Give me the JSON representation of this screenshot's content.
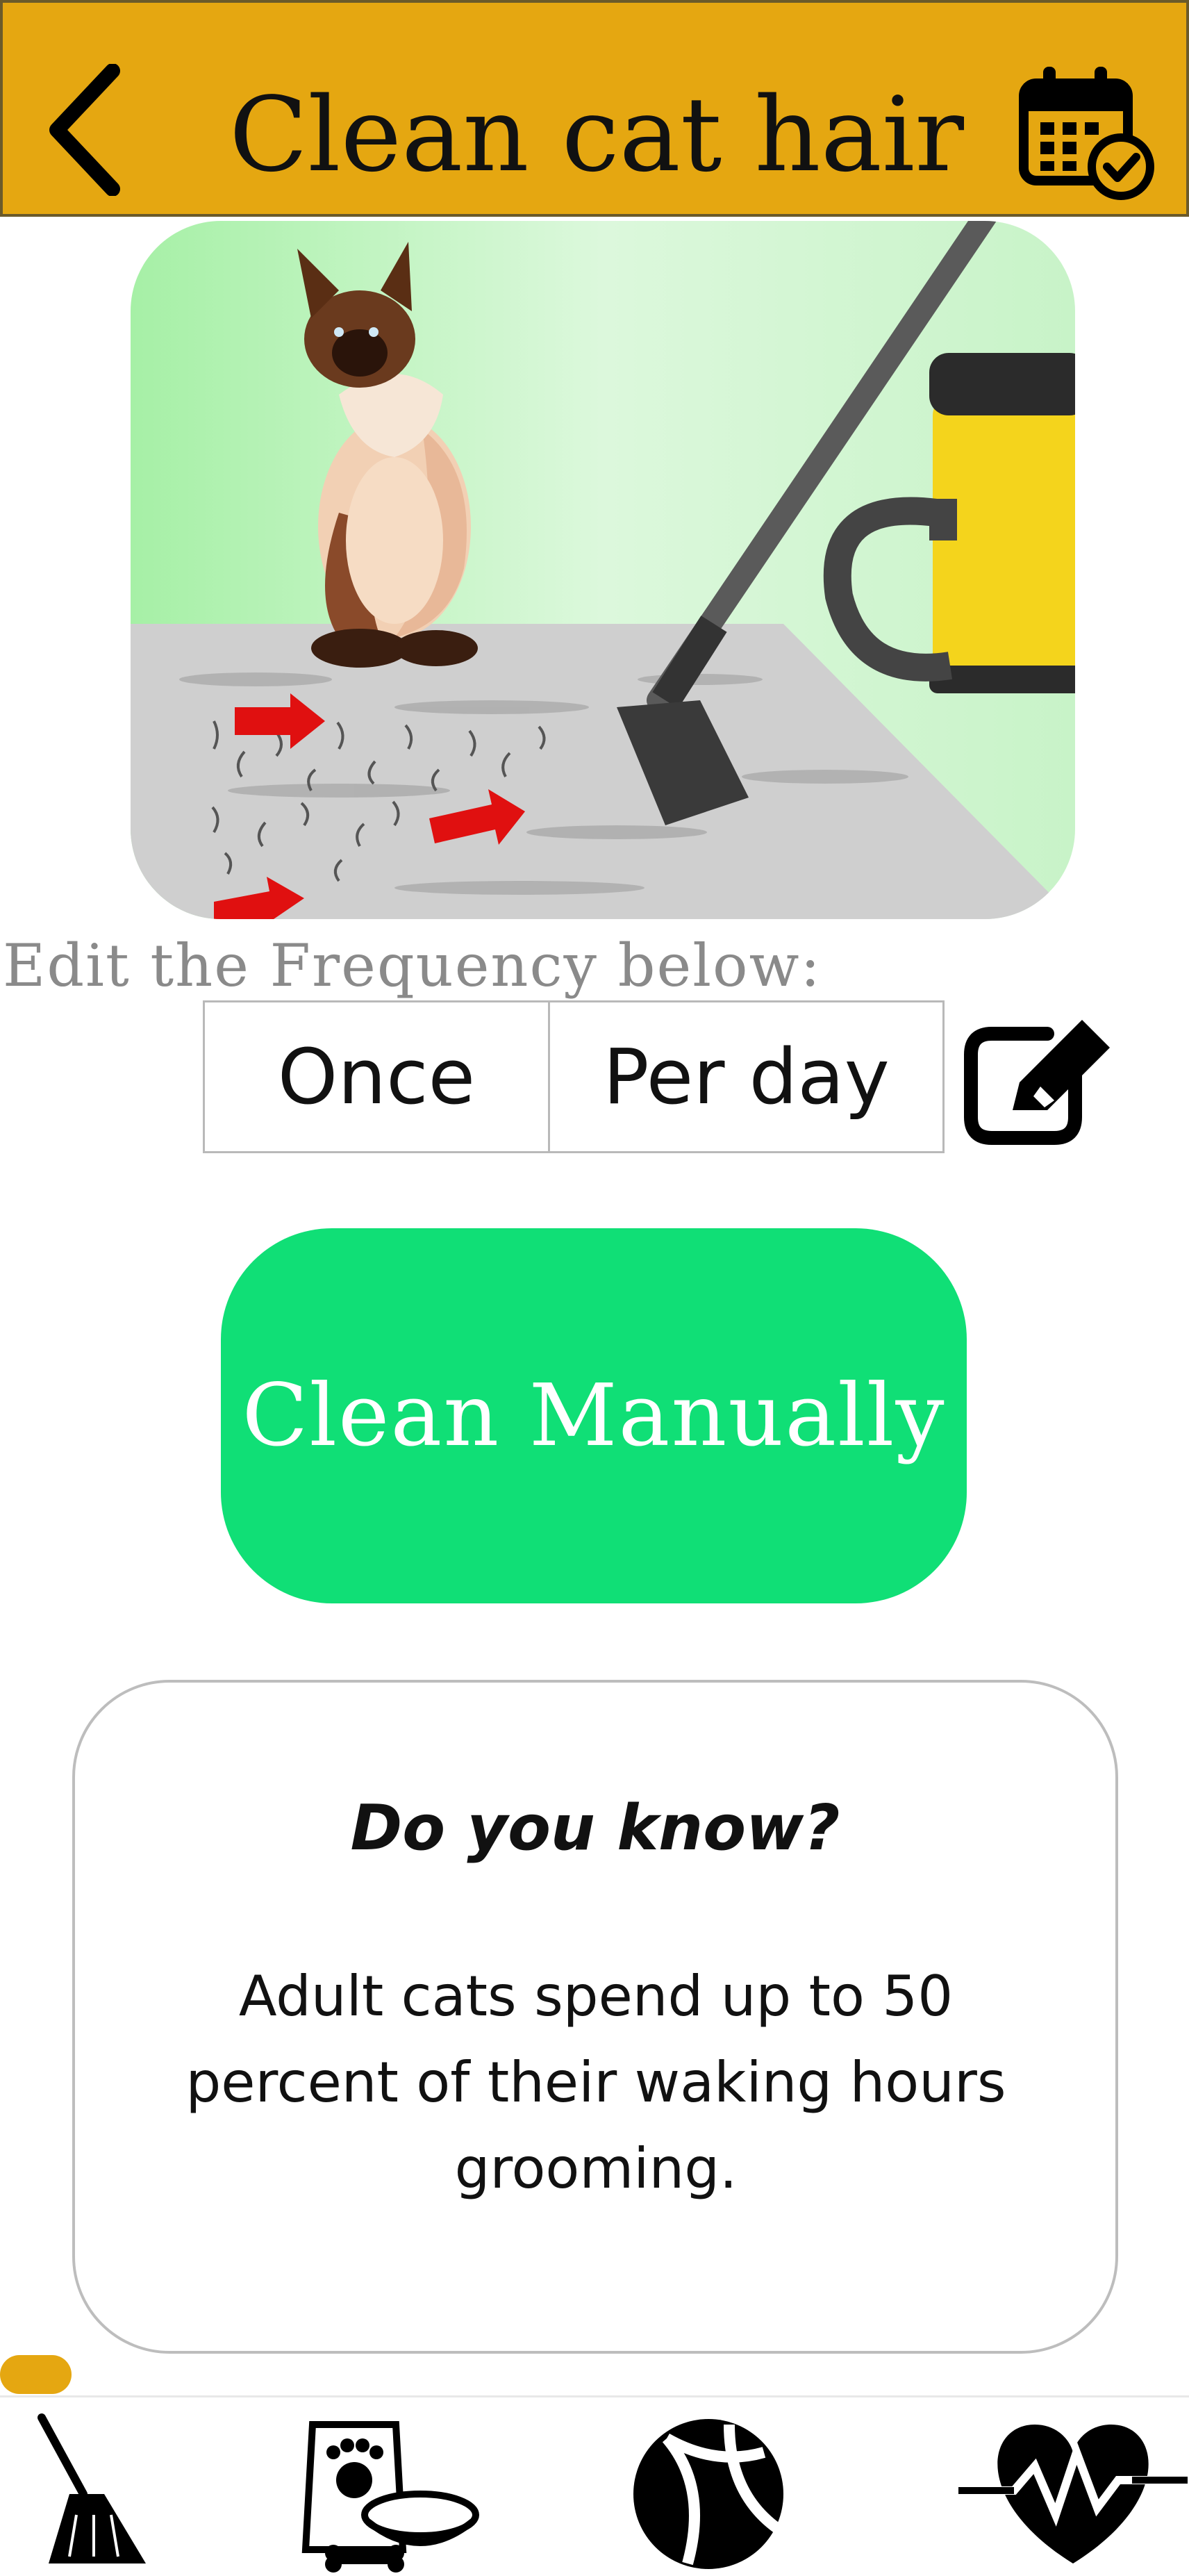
{
  "header": {
    "title": "Clean cat hair",
    "back_icon": "chevron-left-icon",
    "calendar_icon": "calendar-check-icon",
    "bg_color": "#e5a711"
  },
  "illustration": {
    "icon": "cat-vacuum-illustration"
  },
  "frequency": {
    "label": "Edit the Frequency below:",
    "count": "Once",
    "period": "Per day",
    "edit_icon": "edit-pencil-icon"
  },
  "actions": {
    "clean_label": "Clean Manually",
    "clean_color": "#10df76"
  },
  "fact": {
    "title": "Do you know?",
    "body": "Adult cats spend up to 50 percent of their waking hours grooming."
  },
  "progress": {
    "value": 0.06,
    "color": "#e5a711"
  },
  "nav": {
    "items": [
      {
        "icon": "broom-icon"
      },
      {
        "icon": "pet-food-bowl-icon"
      },
      {
        "icon": "ball-icon"
      },
      {
        "icon": "heartbeat-icon"
      }
    ]
  }
}
